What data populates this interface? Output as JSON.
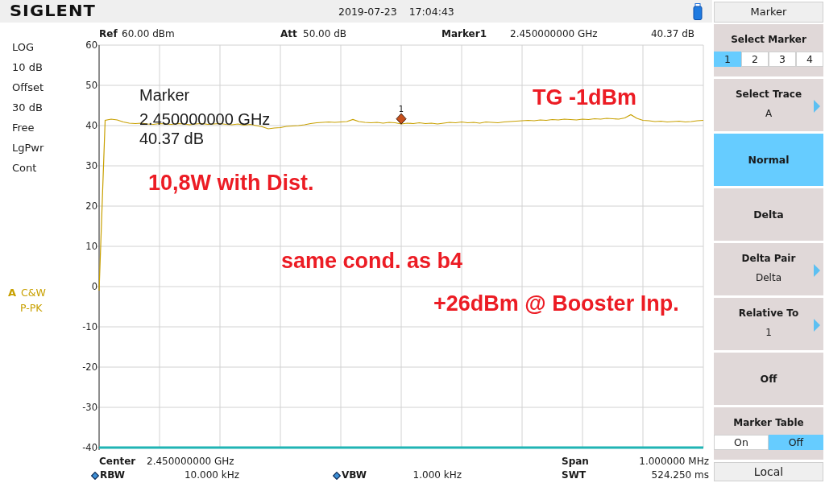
{
  "topbar": {
    "logo": "SIGLENT",
    "date": "2019-07-23",
    "time": "17:04:43"
  },
  "settings": [
    "LOG",
    "10 dB",
    "Offset",
    "30 dB",
    "Free",
    "LgPwr",
    "Cont"
  ],
  "trace": {
    "letter": "A",
    "mode": "C&W",
    "detector": "P-PK"
  },
  "readout": {
    "ref": {
      "label": "Ref",
      "value": "60.00 dBm"
    },
    "att": {
      "label": "Att",
      "value": "50.00 dB"
    },
    "marker": {
      "label": "Marker1",
      "frequency": "2.450000000 GHz",
      "value": "40.37 dB"
    }
  },
  "chart": {
    "chart_data": {
      "type": "line",
      "grid": true,
      "ylim": [
        -40,
        60
      ],
      "yticks": [
        60,
        50,
        40,
        30,
        20,
        10,
        0,
        -10,
        -20,
        -30,
        -40
      ],
      "categories": [
        null,
        null,
        null,
        null,
        null,
        null,
        null,
        null,
        null,
        null,
        null,
        null,
        null,
        null,
        null,
        null,
        null,
        null,
        null,
        null,
        null,
        null,
        null,
        null,
        null,
        null,
        null,
        null,
        null,
        null,
        null,
        null,
        null,
        null,
        null,
        null,
        null,
        null,
        null,
        null,
        null,
        null,
        null,
        null,
        null,
        null,
        null,
        null,
        null,
        null,
        null,
        null,
        null,
        null,
        null,
        null,
        null,
        null,
        null,
        null,
        null,
        null,
        null,
        null,
        null,
        null,
        null,
        null,
        null,
        null,
        null,
        null,
        null,
        null,
        null,
        null,
        null,
        null,
        null,
        null,
        null,
        null,
        null,
        null,
        null,
        null,
        null,
        null,
        null,
        null,
        null,
        null,
        null,
        null,
        null,
        null,
        null,
        null,
        null,
        null,
        null
      ],
      "series": [
        {
          "color": "#c8a000",
          "values": [
            -1,
            41.3,
            41.6,
            41.4,
            40.9,
            40.6,
            40.5,
            40.6,
            40.4,
            40.3,
            40.5,
            40.4,
            40.3,
            40.5,
            40.4,
            40.2,
            40.4,
            40.5,
            40.3,
            40.4,
            40.5,
            40.3,
            40.2,
            40.4,
            40.1,
            40.3,
            40.0,
            39.7,
            39.2,
            39.4,
            39.5,
            39.8,
            39.9,
            40.0,
            40.2,
            40.5,
            40.7,
            40.8,
            40.9,
            40.8,
            40.9,
            41.0,
            41.5,
            41.0,
            40.8,
            40.7,
            40.8,
            40.6,
            40.8,
            40.7,
            40.4,
            40.6,
            40.5,
            40.7,
            40.5,
            40.6,
            40.4,
            40.6,
            40.8,
            40.7,
            40.9,
            40.7,
            40.8,
            40.6,
            40.9,
            40.8,
            40.7,
            40.9,
            41.0,
            41.1,
            41.2,
            41.3,
            41.2,
            41.4,
            41.3,
            41.5,
            41.4,
            41.6,
            41.5,
            41.4,
            41.6,
            41.5,
            41.7,
            41.6,
            41.8,
            41.7,
            41.6,
            41.9,
            42.7,
            41.8,
            41.3,
            41.2,
            41.0,
            41.1,
            40.9,
            41.0,
            41.1,
            40.9,
            41.0,
            41.2,
            41.3
          ]
        },
        {
          "color": "#20b4b4",
          "values": [
            -40,
            -40,
            -40,
            -40,
            -40,
            -40,
            -40,
            -40,
            -40,
            -40,
            -40,
            -40,
            -40,
            -40,
            -40,
            -40,
            -40,
            -40,
            -40,
            -40,
            -40,
            -40,
            -40,
            -40,
            -40,
            -40,
            -40,
            -40,
            -40,
            -40,
            -40,
            -40,
            -40,
            -40,
            -40,
            -40,
            -40,
            -40,
            -40,
            -40,
            -40,
            -40,
            -40,
            -40,
            -40,
            -40,
            -40,
            -40,
            -40,
            -40,
            -40,
            -40,
            -40,
            -40,
            -40,
            -40,
            -40,
            -40,
            -40,
            -40,
            -40,
            -40,
            -40,
            -40,
            -40,
            -40,
            -40,
            -40,
            -40,
            -40,
            -40,
            -40,
            -40,
            -40,
            -40,
            -40,
            -40,
            -40,
            -40,
            -40,
            -40,
            -40,
            -40,
            -40,
            -40,
            -40,
            -40,
            -40,
            -40,
            -40,
            -40,
            -40,
            -40,
            -40,
            -40,
            -40,
            -40,
            -40,
            -40,
            -40,
            -40
          ]
        }
      ],
      "annotations": [
        {
          "text": "1",
          "y": 40.37
        }
      ]
    },
    "marker_readout": {
      "title": "Marker",
      "frequency": "2.450000000 GHz",
      "value": "40.37 dB"
    },
    "notes": [
      "TG -1dBm",
      "10,8W with Dist.",
      "same cond. as b4",
      "+26dBm @ Booster Inp."
    ]
  },
  "sweep": {
    "center": {
      "label": "Center",
      "value": "2.450000000 GHz"
    },
    "span": {
      "label": "Span",
      "value": "1.000000 MHz"
    },
    "rbw": {
      "label": "RBW",
      "value": "10.000 kHz"
    },
    "vbw": {
      "label": "VBW",
      "value": "1.000 kHz"
    },
    "swt": {
      "label": "SWT",
      "value": "524.250 ms"
    }
  },
  "softkeys": {
    "title": "Marker",
    "items": [
      {
        "kind": "selector",
        "label": "Select Marker",
        "options": [
          {
            "label": "1",
            "selected": true
          },
          {
            "label": "2",
            "selected": false
          },
          {
            "label": "3",
            "selected": false
          },
          {
            "label": "4",
            "selected": false
          }
        ]
      },
      {
        "kind": "submenu",
        "label": "Select Trace",
        "value": "A"
      },
      {
        "kind": "option",
        "label": "Normal",
        "selected": true
      },
      {
        "kind": "option",
        "label": "Delta",
        "selected": false
      },
      {
        "kind": "submenu",
        "label": "Delta Pair",
        "value": "Delta"
      },
      {
        "kind": "submenu",
        "label": "Relative To",
        "value": "1"
      },
      {
        "kind": "option",
        "label": "Off",
        "selected": false
      },
      {
        "kind": "selector",
        "label": "Marker Table",
        "options": [
          {
            "label": "On",
            "selected": false
          },
          {
            "label": "Off",
            "selected": true
          }
        ]
      }
    ],
    "footer": "Local"
  }
}
